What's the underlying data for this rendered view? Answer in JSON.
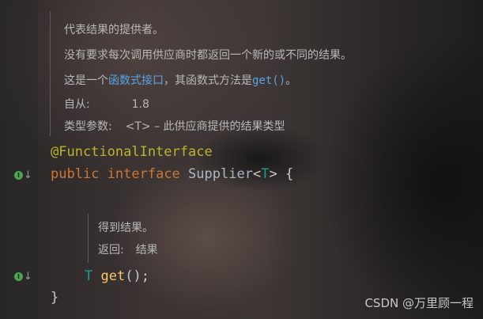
{
  "doc": {
    "line1": "代表结果的提供者。",
    "line2": "没有要求每次调用供应商时都返回一个新的或不同的结果。",
    "line3_prefix": "这是一个",
    "line3_link": "函数式接口",
    "line3_mid": "，其函数式方法是",
    "line3_code": "get()",
    "line3_suffix": "。",
    "since_label": "自从:",
    "since_value": "1.8",
    "typeparam_label": "类型参数:",
    "typeparam_value": "<T> – 此供应商提供的结果类型"
  },
  "code": {
    "annotation": "@FunctionalInterface",
    "kw_public": "public",
    "kw_interface": "interface",
    "class_name": "Supplier",
    "type_open": "<",
    "type_param": "T",
    "type_close": ">",
    "brace_open": "{",
    "ret_type": "T",
    "method_name": "get",
    "method_tail": "();",
    "brace_close": "}"
  },
  "method_doc": {
    "line1": "得到结果。",
    "returns_label": "返回:",
    "returns_value": "结果"
  },
  "gutter": {
    "impl_badge": "I",
    "impl_arrow": "↓"
  },
  "watermark": "CSDN @万里顾一程",
  "colors": {
    "annotation": "#bbb529",
    "keyword": "#cc7832",
    "type_param": "#20999d",
    "method": "#ffc66d",
    "link": "#5aa3e6"
  }
}
